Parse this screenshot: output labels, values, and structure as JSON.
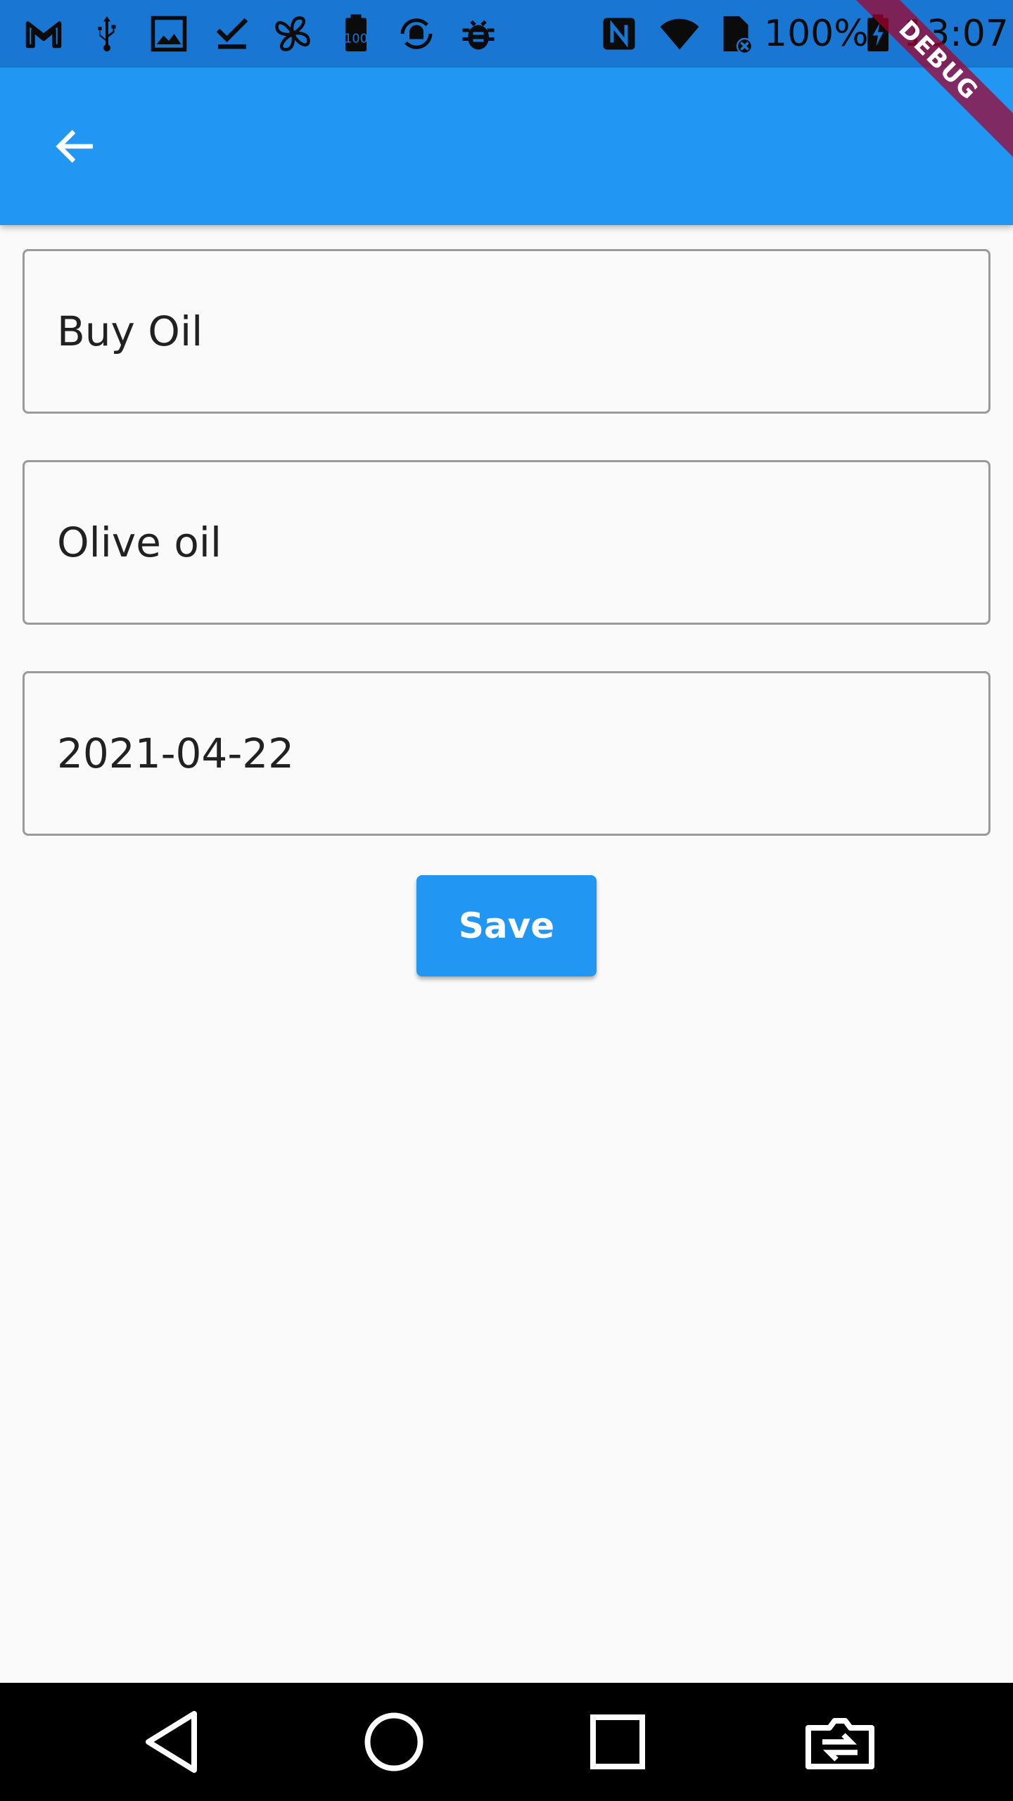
{
  "status_bar": {
    "battery": "100%",
    "time": "13:07",
    "icons": [
      "gmail-icon",
      "usb-icon",
      "image-icon",
      "download-done-icon",
      "pinwheel-icon",
      "battery-100-icon",
      "android-sync-icon",
      "bug-icon",
      "nfc-icon",
      "wifi-icon",
      "sim-off-icon",
      "battery-charging-icon"
    ]
  },
  "debug_banner": "DEBUG",
  "app_bar": {
    "back_icon": "arrow-back-icon"
  },
  "form": {
    "title_value": "Buy Oil",
    "description_value": "Olive oil",
    "date_value": "2021-04-22",
    "save_label": "Save"
  },
  "colors": {
    "app_bar": "#2196f3",
    "status_bar": "#1976d2",
    "background": "#fafafa",
    "button": "#2196f3"
  },
  "nav_bar": {
    "icons": [
      "back-triangle-icon",
      "home-circle-icon",
      "recents-square-icon",
      "switch-camera-icon"
    ]
  }
}
